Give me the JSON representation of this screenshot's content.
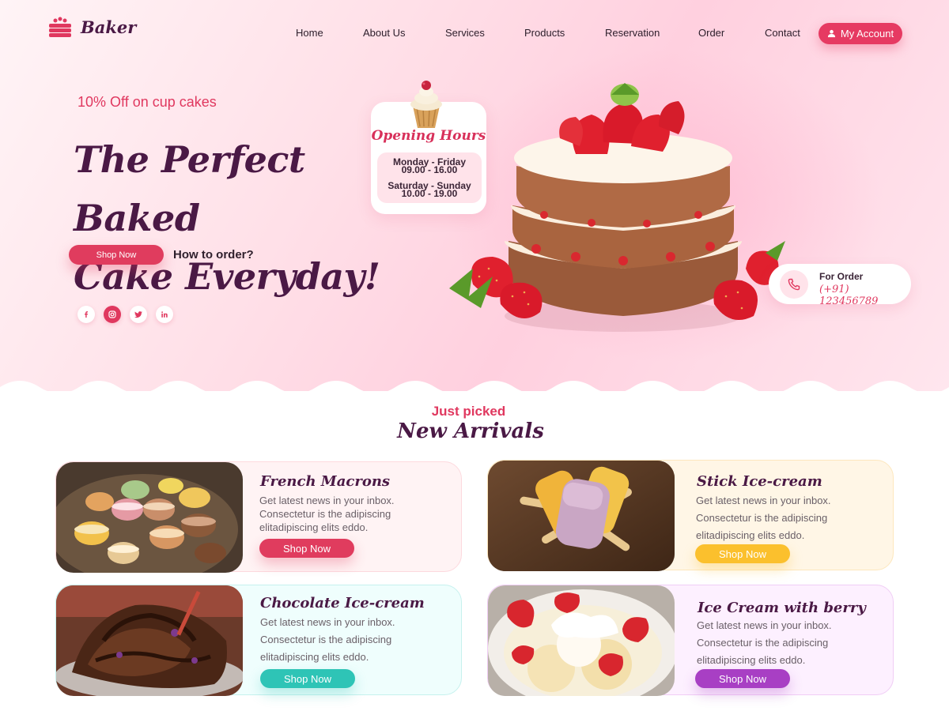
{
  "brand": {
    "name": "Baker"
  },
  "nav": {
    "items": [
      "Home",
      "About Us",
      "Services",
      "Products",
      "Reservation",
      "Order",
      "Contact"
    ],
    "account_label": "My Account"
  },
  "hero": {
    "promo": "10% Off on cup cakes",
    "headline_line1": "The Perfect Baked",
    "headline_line2": "Cake Everyday!",
    "shop_now": "Shop Now",
    "how_to_order": "How to order?",
    "socials": [
      "f",
      "ig",
      "tw",
      "in"
    ]
  },
  "hours": {
    "title": "Opening Hours",
    "weekday_label": "Monday - Friday",
    "weekday_time": "09.00 - 16.00",
    "weekend_label": "Saturday - Sunday",
    "weekend_time": "10.00 - 19.00"
  },
  "order": {
    "label": "For Order",
    "phone": "(+91) 123456789"
  },
  "arrivals": {
    "subtitle": "Just picked",
    "title": "New Arrivals",
    "cards": [
      {
        "title": "French Macrons",
        "line1": "Get latest news in your inbox.",
        "line2": "Consectetur is the  adipiscing",
        "line3": "elitadipiscing elits eddo.",
        "button": "Shop Now",
        "accent": "#e03c5e"
      },
      {
        "title": "Stick Ice-cream",
        "line1": "Get latest news in your inbox.",
        "line2": "Consectetur is the  adipiscing",
        "line3": "elitadipiscing elits eddo.",
        "button": "Shop Now",
        "accent": "#fbc02d"
      },
      {
        "title": "Chocolate Ice-cream",
        "line1": "Get latest news in your inbox.",
        "line2": "Consectetur is the  adipiscing",
        "line3": "elitadipiscing elits eddo.",
        "button": "Shop Now",
        "accent": "#2ec4b6"
      },
      {
        "title": "Ice Cream with berry",
        "line1": "Get latest news in your inbox.",
        "line2": "Consectetur is the  adipiscing",
        "line3": "elitadipiscing elits eddo.",
        "button": "Shop Now",
        "accent": "#a83fc4"
      }
    ]
  },
  "colors": {
    "primary": "#e0385f",
    "brand_text": "#4a1945"
  }
}
